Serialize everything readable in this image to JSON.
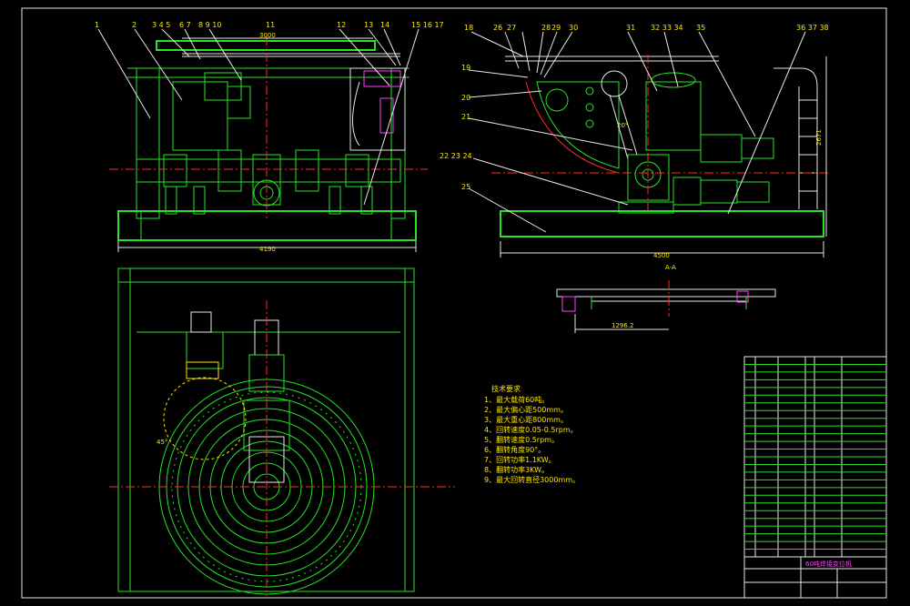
{
  "views": {
    "front": {
      "balloons": [
        "1",
        "2",
        "3 4 5",
        "6 7",
        "8 9 10",
        "11",
        "12",
        "13",
        "14",
        "15 16 17"
      ],
      "dim_top": "3000",
      "dim_width": "4190"
    },
    "side": {
      "balloons_top": [
        "18",
        "26",
        "27",
        "28",
        "29",
        "30",
        "31",
        "32 33 34",
        "35",
        "36 37 38"
      ],
      "balloons_left": [
        "19",
        "20",
        "21",
        "22 23 24",
        "25"
      ],
      "dim_width": "4500",
      "dim_height": "2671",
      "angle": "20°"
    },
    "plan": {
      "angle": "45°"
    },
    "section": {
      "mark": "A-A",
      "dim": "1296.2"
    }
  },
  "tech_requirements": {
    "title": "技术要求",
    "items": [
      "1、最大载荷60吨。",
      "2、最大偏心距500mm。",
      "3、最大重心距800mm。",
      "4、回转速度0.05-0.5rpm。",
      "5、翻转速度0.5rpm。",
      "6、翻转角度90°。",
      "7、回转功率1.1KW。",
      "8、翻转功率3KW。",
      "9、最大回转直径3000mm。"
    ]
  },
  "title_block": {
    "drawing_title": "60吨焊接变位机",
    "bom_rows": 26
  },
  "colors": {
    "background": "#000000",
    "frame": "#27e327",
    "text": "#ffe600",
    "center": "#ff2a2a",
    "accent": "#ff40ff",
    "outline": "#e8e8e8"
  }
}
